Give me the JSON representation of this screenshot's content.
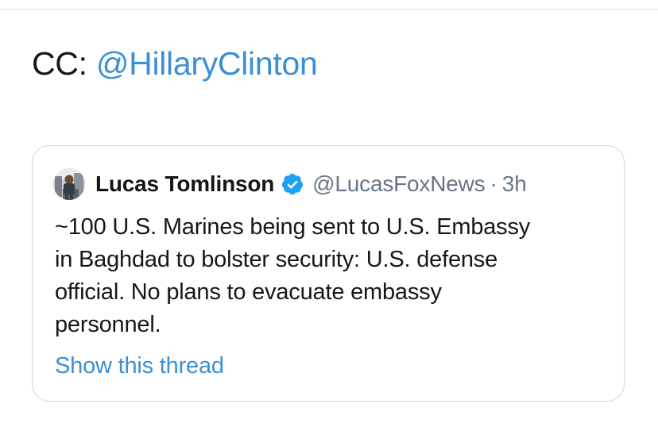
{
  "tweet": {
    "prefix": "CC: ",
    "mention": "@HillaryClinton"
  },
  "quoted_tweet": {
    "author_name": "Lucas Tomlinson",
    "verified": true,
    "handle": "@LucasFoxNews",
    "separator": "·",
    "time": "3h",
    "text": "~100 U.S. Marines being sent to U.S. Embassy\nin Baghdad to bolster security: U.S. defense\nofficial. No plans to evacuate embassy\npersonnel.",
    "show_thread_label": "Show this thread",
    "avatar_icon": "profile-photo",
    "verified_icon": "verified-badge-icon"
  },
  "colors": {
    "link": "#3b8fd6",
    "text": "#14171a",
    "secondary": "#657786",
    "border": "#ccd6dd",
    "verified": "#1da1f2"
  }
}
